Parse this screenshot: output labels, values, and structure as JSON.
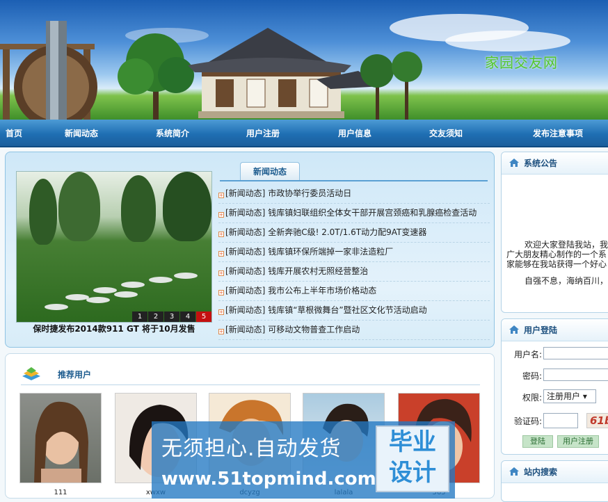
{
  "header": {
    "site_title": "家园交友网"
  },
  "nav": {
    "items": [
      {
        "label": "首页"
      },
      {
        "label": "新闻动态"
      },
      {
        "label": "系统简介"
      },
      {
        "label": "用户注册"
      },
      {
        "label": "用户信息"
      },
      {
        "label": "交友须知"
      },
      {
        "label": "发布注意事项"
      }
    ]
  },
  "slideshow": {
    "caption": "保时捷发布2014款911 GT 将于10月发售",
    "pages": [
      "1",
      "2",
      "3",
      "4",
      "5"
    ],
    "active_page": "5"
  },
  "news": {
    "tab_label": "新闻动态",
    "items": [
      {
        "tag": "[新闻动态]",
        "title": "市政协举行委员活动日"
      },
      {
        "tag": "[新闻动态]",
        "title": "钱库镇妇联组织全体女干部开展宫颈癌和乳腺癌检查活动"
      },
      {
        "tag": "[新闻动态]",
        "title": "全新奔驰C级! 2.0T/1.6T动力配9AT变速器"
      },
      {
        "tag": "[新闻动态]",
        "title": "钱库镇环保所端掉一家非法造粒厂"
      },
      {
        "tag": "[新闻动态]",
        "title": "钱库开展农村无照经营整治"
      },
      {
        "tag": "[新闻动态]",
        "title": "我市公布上半年市场价格动态"
      },
      {
        "tag": "[新闻动态]",
        "title": "钱库镇“草根微舞台”暨社区文化节活动启动"
      },
      {
        "tag": "[新闻动态]",
        "title": "可移动文物普查工作启动"
      }
    ]
  },
  "recommended": {
    "title": "推荐用户",
    "users": [
      {
        "name": "111"
      },
      {
        "name": "xwxw"
      },
      {
        "name": "dcyzg"
      },
      {
        "name": "lalala"
      },
      {
        "name": "565"
      }
    ]
  },
  "announcement": {
    "title": "系统公告",
    "lines": [
      "欢迎大家登陆我站，我",
      "广大朋友精心制作的一个系",
      "家能够在我站获得一个好心",
      "自强不息，海纳百川，"
    ]
  },
  "login": {
    "title": "用户登陆",
    "username_label": "用户名:",
    "password_label": "密码:",
    "role_label": "权限:",
    "role_value": "注册用户",
    "captcha_label": "验证码:",
    "captcha_text": "61b",
    "login_button": "登陆",
    "register_button": "用户注册"
  },
  "search": {
    "title": "站内搜索"
  },
  "watermark": {
    "line1": "无须担心.自动发货",
    "line2": "www.51topmind.com",
    "box_line1": "毕业",
    "box_line2": "设计"
  },
  "colors": {
    "nav": "#1f6fb3",
    "accent": "#1c5b8e",
    "active_page": "#c41010",
    "site_title": "#54c62e"
  }
}
